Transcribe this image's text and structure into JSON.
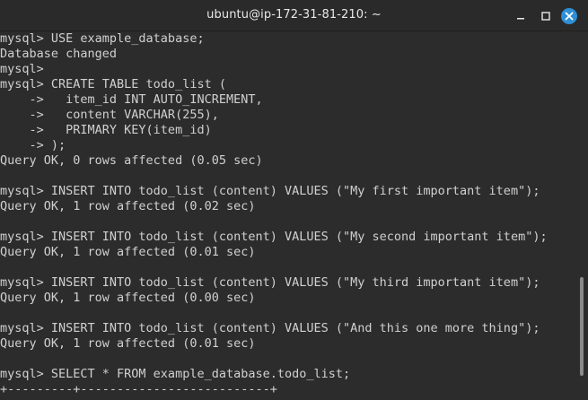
{
  "window": {
    "title": "ubuntu@ip-172-31-81-210: ~"
  },
  "controls": {
    "minimize_icon": "minimize-icon",
    "maximize_icon": "maximize-icon",
    "close_icon": "close-icon",
    "close_color": "#2d8fd6"
  },
  "terminal": {
    "text_color": "#d0d0d0",
    "background": "#2c2c2c",
    "lines": [
      "mysql> USE example_database;",
      "Database changed",
      "mysql>",
      "mysql> CREATE TABLE todo_list (",
      "    ->   item_id INT AUTO_INCREMENT,",
      "    ->   content VARCHAR(255),",
      "    ->   PRIMARY KEY(item_id)",
      "    -> );",
      "Query OK, 0 rows affected (0.05 sec)",
      "",
      "mysql> INSERT INTO todo_list (content) VALUES (\"My first important item\");",
      "Query OK, 1 row affected (0.02 sec)",
      "",
      "mysql> INSERT INTO todo_list (content) VALUES (\"My second important item\");",
      "Query OK, 1 row affected (0.01 sec)",
      "",
      "mysql> INSERT INTO todo_list (content) VALUES (\"My third important item\");",
      "Query OK, 1 row affected (0.00 sec)",
      "",
      "mysql> INSERT INTO todo_list (content) VALUES (\"And this one more thing\");",
      "Query OK, 1 row affected (0.01 sec)",
      "",
      "mysql> SELECT * FROM example_database.todo_list;",
      "+---------+--------------------------+"
    ]
  }
}
